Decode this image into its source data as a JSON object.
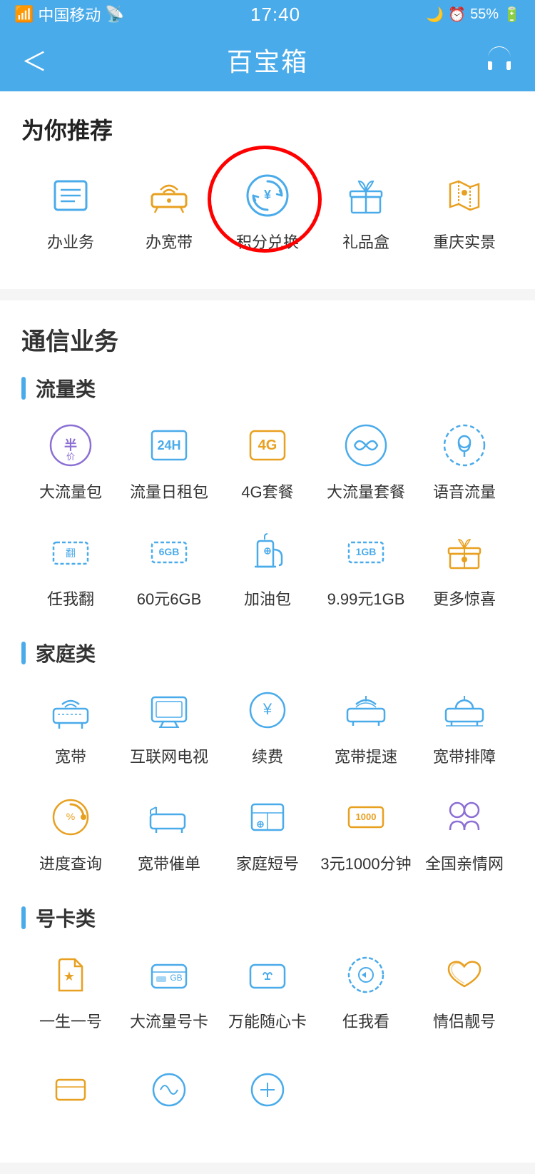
{
  "statusBar": {
    "carrier": "中国移动",
    "wifi": "WiFi",
    "time": "17:40",
    "battery": "55%"
  },
  "navBar": {
    "back": "‹",
    "title": "百宝箱",
    "headset": "🎧"
  },
  "recommend": {
    "sectionTitle": "为你推荐",
    "items": [
      {
        "label": "办业务",
        "icon": "business"
      },
      {
        "label": "办宽带",
        "icon": "broadband"
      },
      {
        "label": "积分兑换",
        "icon": "points",
        "annotated": true
      },
      {
        "label": "礼品盒",
        "icon": "gift"
      },
      {
        "label": "重庆实景",
        "icon": "map"
      }
    ]
  },
  "telecom": {
    "sectionTitle": "通信业务",
    "subSections": [
      {
        "subTitle": "流量类",
        "items": [
          {
            "label": "大流量包",
            "icon": "half-price"
          },
          {
            "label": "流量日租包",
            "icon": "24h"
          },
          {
            "label": "4G套餐",
            "icon": "4g"
          },
          {
            "label": "大流量套餐",
            "icon": "infinite"
          },
          {
            "label": "语音流量",
            "icon": "voice"
          },
          {
            "label": "任我翻",
            "icon": "flip"
          },
          {
            "label": "60元6GB",
            "icon": "6gb"
          },
          {
            "label": "加油包",
            "icon": "fuel"
          },
          {
            "label": "9.99元1GB",
            "icon": "1gb"
          },
          {
            "label": "更多惊喜",
            "icon": "more-gift"
          }
        ]
      },
      {
        "subTitle": "家庭类",
        "items": [
          {
            "label": "宽带",
            "icon": "router"
          },
          {
            "label": "互联网电视",
            "icon": "tv"
          },
          {
            "label": "续费",
            "icon": "renew"
          },
          {
            "label": "宽带提速",
            "icon": "speedup"
          },
          {
            "label": "宽带排障",
            "icon": "repair"
          },
          {
            "label": "进度查询",
            "icon": "progress"
          },
          {
            "label": "宽带催单",
            "icon": "urge"
          },
          {
            "label": "家庭短号",
            "icon": "short-num"
          },
          {
            "label": "3元1000分钟",
            "icon": "minutes"
          },
          {
            "label": "全国亲情网",
            "icon": "family-net"
          }
        ]
      },
      {
        "subTitle": "号卡类",
        "items": [
          {
            "label": "一生一号",
            "icon": "lifetime"
          },
          {
            "label": "大流量号卡",
            "icon": "traffic-card"
          },
          {
            "label": "万能随心卡",
            "icon": "wish-card"
          },
          {
            "label": "任我看",
            "icon": "watch"
          },
          {
            "label": "情侣靓号",
            "icon": "couple"
          }
        ]
      }
    ]
  }
}
